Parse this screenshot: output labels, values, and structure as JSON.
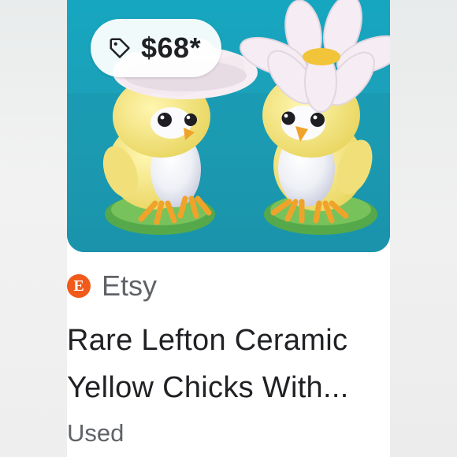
{
  "listing": {
    "price": "$68*",
    "merchant_initial": "E",
    "merchant": "Etsy",
    "title_line1": "Rare Lefton Ceramic",
    "title_line2": "Yellow Chicks With...",
    "condition": "Used"
  },
  "icons": {
    "price_tag": "price-tag-icon",
    "merchant_logo": "etsy-logo-icon"
  },
  "colors": {
    "photo_background": "#1aa0b8",
    "merchant_logo": "#f05a1a",
    "text_primary": "#202124",
    "text_secondary": "#5f6368"
  }
}
